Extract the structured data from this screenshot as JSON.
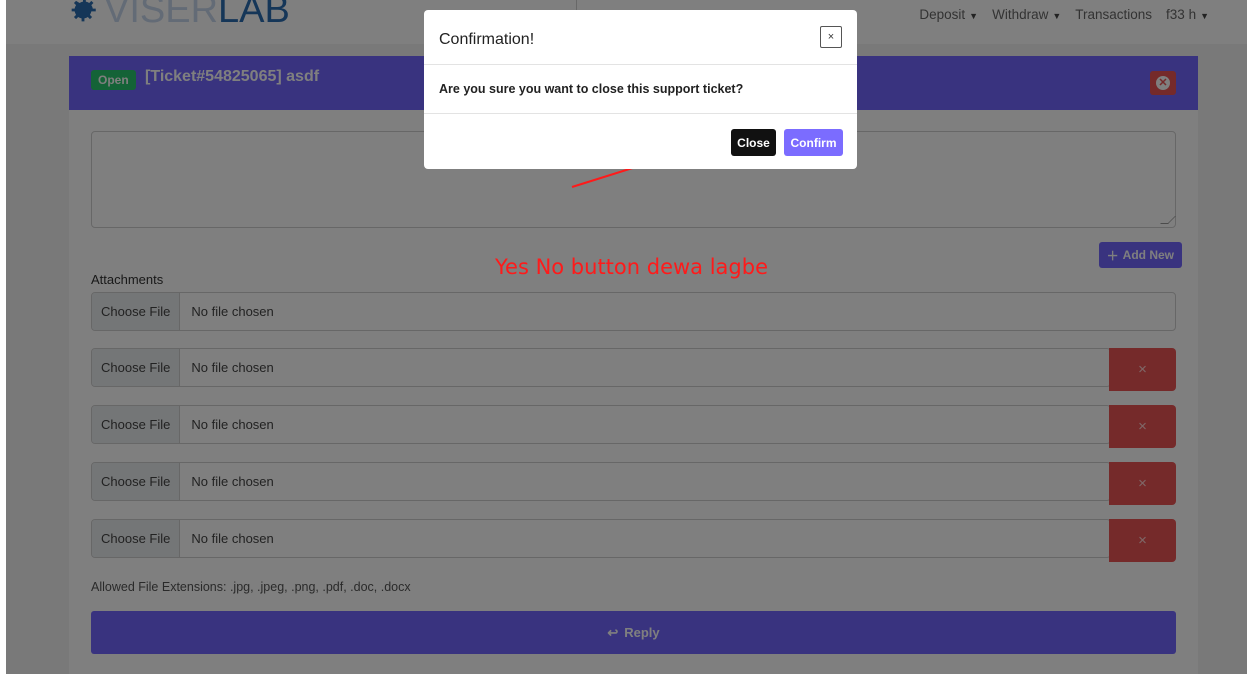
{
  "navbar": {
    "logo_light": "VISER",
    "logo_dark": "LAB",
    "links": [
      {
        "label": "Deposit",
        "caret": "▼"
      },
      {
        "label": "Withdraw",
        "caret": "▼"
      },
      {
        "label": "Transactions",
        "caret": ""
      },
      {
        "label": "f33 h",
        "caret": "▼"
      }
    ]
  },
  "ticket": {
    "status": "Open",
    "title": "[Ticket#54825065] asdf",
    "header_color": "#7366ff"
  },
  "form": {
    "message_value": "",
    "add_new_label": "Add New",
    "attachments_label": "Attachments",
    "files": [
      {
        "choose": "Choose File",
        "status": "No file chosen",
        "removable": false
      },
      {
        "choose": "Choose File",
        "status": "No file chosen",
        "removable": true
      },
      {
        "choose": "Choose File",
        "status": "No file chosen",
        "removable": true
      },
      {
        "choose": "Choose File",
        "status": "No file chosen",
        "removable": true
      },
      {
        "choose": "Choose File",
        "status": "No file chosen",
        "removable": true
      }
    ],
    "remove_symbol": "×",
    "allowed_extensions": "Allowed File Extensions: .jpg, .jpeg, .png, .pdf, .doc, .docx",
    "reply_label": "Reply"
  },
  "modal": {
    "title": "Confirmation!",
    "close_x": "×",
    "body": "Are you sure you want to close this support ticket?",
    "close_label": "Close",
    "confirm_label": "Confirm"
  },
  "annotation": {
    "text": "Yes No button dewa lagbe",
    "color": "#ff1a1a"
  }
}
